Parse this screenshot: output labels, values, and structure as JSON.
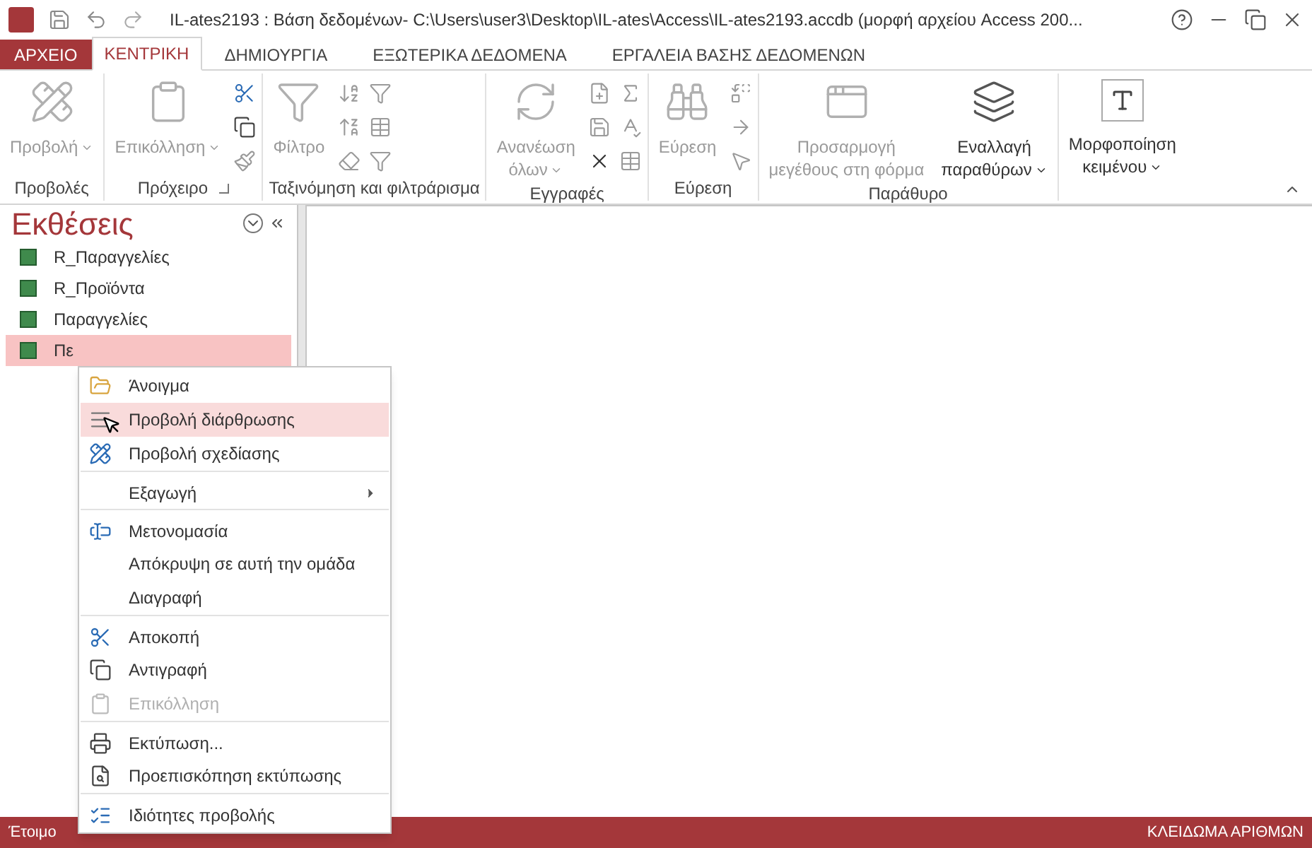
{
  "window": {
    "title": "IL-ates2193 : Βάση δεδομένων- C:\\Users\\user3\\Desktop\\IL-ates\\Access\\IL-ates2193.accdb (μορφή αρχείου Access 200..."
  },
  "tabs": [
    {
      "label": "ΑΡΧΕΙΟ",
      "kind": "file",
      "selected": false
    },
    {
      "label": "ΚΕΝΤΡΙΚΗ",
      "kind": "tab",
      "selected": true
    },
    {
      "label": "ΔΗΜΙΟΥΡΓΙΑ",
      "kind": "tab",
      "selected": false
    },
    {
      "label": "ΕΞΩΤΕΡΙΚΑ ΔΕΔΟΜΕΝΑ",
      "kind": "tab",
      "selected": false
    },
    {
      "label": "ΕΡΓΑΛΕΙΑ ΒΑΣΗΣ ΔΕΔΟΜΕΝΩΝ",
      "kind": "tab",
      "selected": false
    }
  ],
  "ribbon": {
    "groups": [
      {
        "label": "Προβολές",
        "kind": "views",
        "launcher": false,
        "buttons": [
          {
            "lines": [
              "Προβολή"
            ],
            "disabled": true,
            "dropdown": true
          }
        ]
      },
      {
        "label": "Πρόχειρο",
        "kind": "clipboard",
        "launcher": true,
        "buttons": [
          {
            "lines": [
              "Επικόλληση"
            ],
            "disabled": true,
            "dropdown": true
          }
        ]
      },
      {
        "label": "Ταξινόμηση και φιλτράρισμα",
        "kind": "sort",
        "launcher": false,
        "buttons": [
          {
            "lines": [
              "Φίλτρο"
            ],
            "disabled": true,
            "dropdown": false
          }
        ]
      },
      {
        "label": "Εγγραφές",
        "kind": "records",
        "launcher": false,
        "buttons": [
          {
            "lines": [
              "Ανανέωση",
              "όλων"
            ],
            "disabled": true,
            "dropdown": true
          }
        ]
      },
      {
        "label": "Εύρεση",
        "kind": "find",
        "launcher": false,
        "buttons": [
          {
            "lines": [
              "Εύρεση"
            ],
            "disabled": true,
            "dropdown": false
          }
        ]
      },
      {
        "label": "Παράθυρο",
        "kind": "window",
        "launcher": false,
        "buttons": [
          {
            "lines": [
              "Προσαρμογή",
              "μεγέθους στη φόρμα"
            ],
            "disabled": true,
            "dropdown": false
          },
          {
            "lines": [
              "Εναλλαγή",
              "παραθύρων"
            ],
            "disabled": false,
            "dropdown": true
          }
        ]
      },
      {
        "kind": "text",
        "launcher": false,
        "buttons": [
          {
            "lines": [
              "Μορφοποίηση",
              "κειμένου"
            ],
            "disabled": false,
            "dropdown": true
          }
        ]
      }
    ]
  },
  "nav": {
    "title": "Εκθέσεις",
    "items": [
      {
        "label": "R_Παραγγελίες",
        "selected": false
      },
      {
        "label": "R_Προϊόντα",
        "selected": false
      },
      {
        "label": "Παραγγελίες",
        "selected": false
      },
      {
        "label": "Πε",
        "selected": true
      }
    ]
  },
  "context_menu": [
    {
      "label": "Άνοιγμα",
      "selected": false,
      "disabled": false,
      "submenu": false,
      "separator_before": false
    },
    {
      "label": "Προβολή διάρθρωσης",
      "selected": true,
      "disabled": false,
      "submenu": false,
      "separator_before": false
    },
    {
      "label": "Προβολή σχεδίασης",
      "selected": false,
      "disabled": false,
      "submenu": false,
      "separator_before": false
    },
    {
      "label": "Εξαγωγή",
      "selected": false,
      "disabled": false,
      "submenu": true,
      "separator_before": true
    },
    {
      "label": "Μετονομασία",
      "selected": false,
      "disabled": false,
      "submenu": false,
      "separator_before": true
    },
    {
      "label": "Απόκρυψη σε αυτή την ομάδα",
      "selected": false,
      "disabled": false,
      "submenu": false,
      "separator_before": false
    },
    {
      "label": "Διαγραφή",
      "selected": false,
      "disabled": false,
      "submenu": false,
      "separator_before": false
    },
    {
      "label": "Αποκοπή",
      "selected": false,
      "disabled": false,
      "submenu": false,
      "separator_before": true
    },
    {
      "label": "Αντιγραφή",
      "selected": false,
      "disabled": false,
      "submenu": false,
      "separator_before": false
    },
    {
      "label": "Επικόλληση",
      "selected": false,
      "disabled": true,
      "submenu": false,
      "separator_before": false
    },
    {
      "label": "Εκτύπωση...",
      "selected": false,
      "disabled": false,
      "submenu": false,
      "separator_before": true
    },
    {
      "label": "Προεπισκόπηση εκτύπωσης",
      "selected": false,
      "disabled": false,
      "submenu": false,
      "separator_before": false
    },
    {
      "label": "Ιδιότητες προβολής",
      "selected": false,
      "disabled": false,
      "submenu": false,
      "separator_before": true
    }
  ],
  "status_bar": {
    "left": "Έτοιμο",
    "right": "ΚΛΕΙΔΩΜΑ ΑΡΙΘΜΩΝ"
  }
}
